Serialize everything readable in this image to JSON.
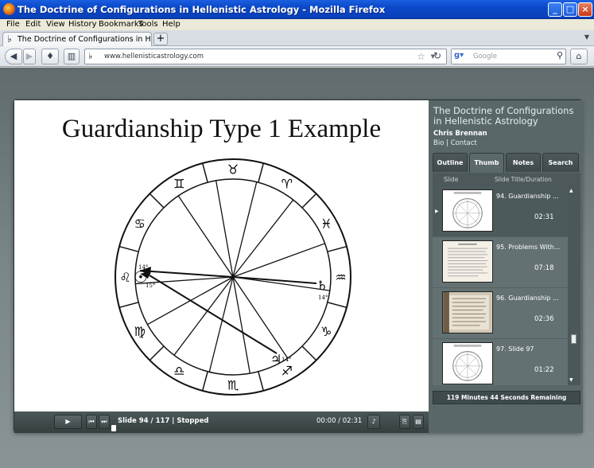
{
  "window": {
    "title": "The Doctrine of Configurations in Hellenistic Astrology - Mozilla Firefox"
  },
  "menu": [
    "File",
    "Edit",
    "View",
    "History",
    "Bookmarks",
    "Tools",
    "Help"
  ],
  "tab": {
    "label": "The Doctrine of Configurations in Hellenistic ..."
  },
  "address": {
    "url": "www.hellenisticastrology.com"
  },
  "search": {
    "engine": "Google",
    "placeholder": "Google"
  },
  "slide": {
    "title": "Guardianship Type 1 Example",
    "chart": {
      "signs": [
        "♉",
        "♈",
        "♓",
        "♒",
        "♑",
        "♐",
        "♏",
        "♎",
        "♍",
        "♌",
        "♋",
        "♊"
      ],
      "planets": [
        {
          "glyph": "☉",
          "degree": "15°"
        },
        {
          "glyph": "♄",
          "degree": "14°"
        },
        {
          "glyph": "♃",
          "degree": "14°"
        }
      ],
      "asc_degree": "14°"
    }
  },
  "controls": {
    "play": "▶",
    "prev": "⏮",
    "next": "⏭",
    "slide_info": "Slide 94 / 117 | Stopped",
    "time": "00:00 / 02:31",
    "progress": 0
  },
  "sidebar": {
    "title": "The Doctrine of Configurations in Hellenistic Astrology",
    "presenter": "Chris Brennan",
    "links": [
      "Bio",
      "Contact"
    ],
    "tabs": [
      "Outline",
      "Thumb",
      "Notes",
      "Search"
    ],
    "active_tab": "Thumb",
    "columns": [
      "Slide",
      "Slide Title/Duration"
    ],
    "rows": [
      {
        "title": "94. Guardianship ...",
        "duration": "02:31"
      },
      {
        "title": "95. Problems With...",
        "duration": "07:18"
      },
      {
        "title": "96. Guardianship ...",
        "duration": "02:36"
      },
      {
        "title": "97. Slide 97",
        "duration": "01:22"
      }
    ],
    "remaining": "119 Minutes 44 Seconds Remaining"
  },
  "colors": {
    "titlebar": "#0a48c8",
    "player_bg": "#2f3b3d",
    "sidebar_bg": "#5a6769"
  }
}
